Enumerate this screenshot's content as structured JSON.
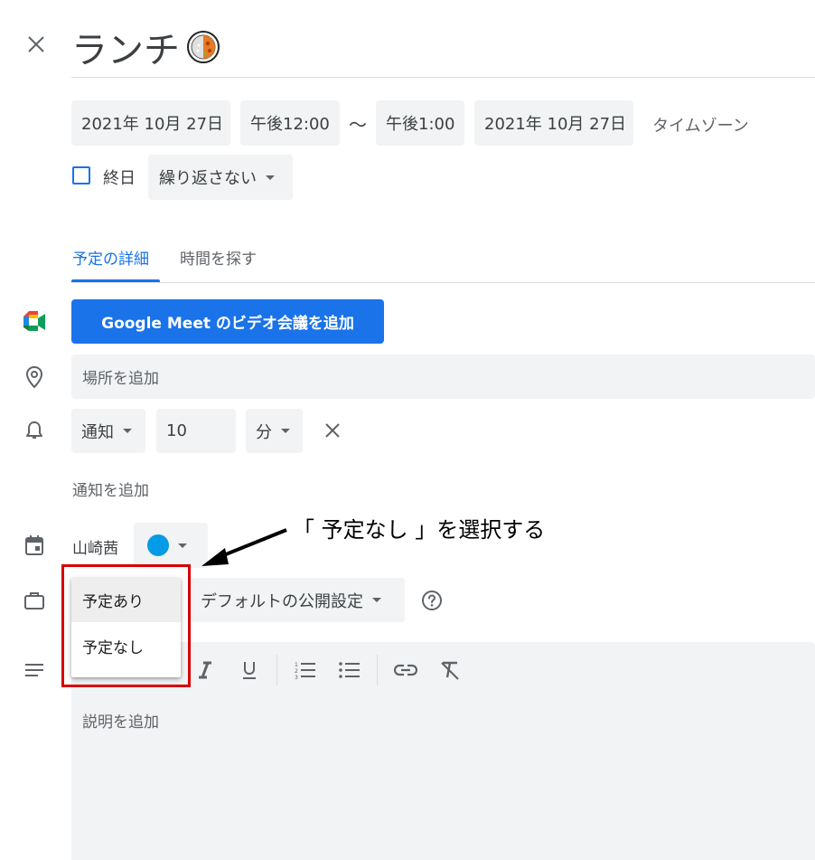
{
  "header": {
    "close_icon": "close-icon",
    "title": "ランチ"
  },
  "datetime": {
    "start_date": "2021年 10月 27日",
    "start_time": "午後12:00",
    "separator": "〜",
    "end_time": "午後1:00",
    "end_date": "2021年 10月 27日",
    "timezone": "タイムゾーン"
  },
  "allday": {
    "label": "終日",
    "checked": false,
    "repeat": "繰り返さない"
  },
  "tabs": [
    {
      "label": "予定の詳細",
      "active": true
    },
    {
      "label": "時間を探す",
      "active": false
    }
  ],
  "meet": {
    "button_label": "Google Meet のビデオ会議を追加"
  },
  "location": {
    "placeholder": "場所を追加"
  },
  "notification": {
    "type": "通知",
    "value": "10",
    "unit": "分",
    "add_label": "通知を追加"
  },
  "calendar": {
    "owner": "山崎茜",
    "color": "#039be5"
  },
  "availability": {
    "options": [
      "予定あり",
      "予定なし"
    ],
    "selected": "予定あり",
    "visibility": "デフォルトの公開設定"
  },
  "description": {
    "placeholder": "説明を追加"
  },
  "annotation": {
    "text": "「 予定なし 」を選択する",
    "highlight_color": "#d50000"
  },
  "colors": {
    "accent": "#1a73e8",
    "field_bg": "#f1f3f4"
  }
}
